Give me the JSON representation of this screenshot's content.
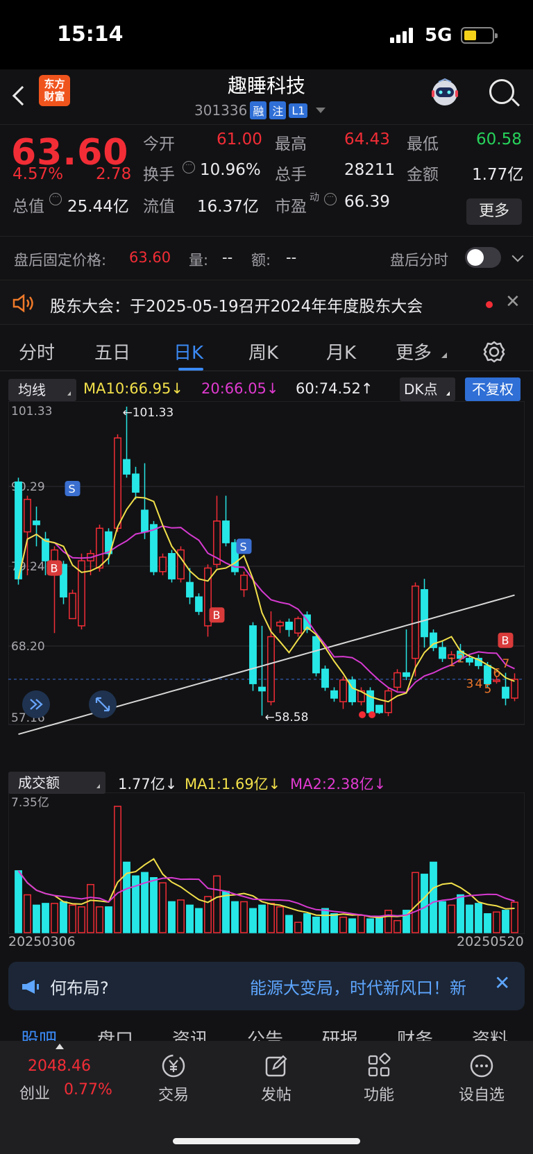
{
  "status_bar": {
    "time": "15:14",
    "network": "5G"
  },
  "header": {
    "logo_line1": "东方",
    "logo_line2": "财富",
    "stock_name": "趣睡科技",
    "stock_code": "301336",
    "tags": [
      "融",
      "注",
      "L1"
    ]
  },
  "quote": {
    "price": "63.60",
    "change_pct": "4.57%",
    "change": "2.78",
    "open_label": "今开",
    "open": "61.00",
    "high_label": "最高",
    "high": "64.43",
    "low_label": "最低",
    "low": "60.58",
    "turnover_label": "换手",
    "turnover": "10.96%",
    "volume_label": "总手",
    "volume": "28211",
    "amount_label": "金额",
    "amount": "1.77亿",
    "mktcap_label": "总值",
    "mktcap": "25.44亿",
    "float_label": "流值",
    "float_cap": "16.37亿",
    "pe_label": "市盈",
    "pe_sup": "动",
    "pe": "66.39",
    "more_button": "更多"
  },
  "after_hours": {
    "label": "盘后固定价格:",
    "price": "63.60",
    "vol_label": "量:",
    "vol": "--",
    "amt_label": "额:",
    "amt": "--",
    "timeline_label": "盘后分时"
  },
  "notice": {
    "text": "股东大会：于2025-05-19召开2024年年度股东大会",
    "close": "✕"
  },
  "tabs": [
    {
      "label": "分时"
    },
    {
      "label": "五日"
    },
    {
      "label": "日K"
    },
    {
      "label": "周K"
    },
    {
      "label": "月K"
    },
    {
      "label": "更多"
    }
  ],
  "kline_controls": {
    "indicator_select": "均线",
    "ma10": "MA10:66.95↓",
    "ma20": "20:66.05↓",
    "ma60": "60:74.52↑",
    "dk_button": "DK点",
    "adjust_button": "不复权"
  },
  "chart_data": {
    "type": "candlestick",
    "y_ticks": [
      "101.33",
      "90.29",
      "79.24",
      "68.20",
      "57.16"
    ],
    "ylim": [
      57.16,
      101.33
    ],
    "high_annotation": "101.33",
    "low_annotation": "58.58",
    "signals": [
      "B",
      "S",
      "B",
      "S",
      "B"
    ],
    "dk_numbers": [
      "1",
      "2",
      "3",
      "4",
      "5",
      "6",
      "7"
    ],
    "candles": [
      {
        "o": 90.9,
        "c": 77.5,
        "h": 91.5,
        "l": 76.7
      },
      {
        "o": 84.0,
        "c": 88.5,
        "h": 89.0,
        "l": 78.0
      },
      {
        "o": 85.5,
        "c": 85.0,
        "h": 87.5,
        "l": 82.0
      },
      {
        "o": 83.0,
        "c": 80.0,
        "h": 84.0,
        "l": 78.0
      },
      {
        "o": 78.0,
        "c": 81.5,
        "h": 82.0,
        "l": 70.0
      },
      {
        "o": 79.5,
        "c": 75.0,
        "h": 80.0,
        "l": 74.0
      },
      {
        "o": 72.0,
        "c": 75.5,
        "h": 76.0,
        "l": 72.0
      },
      {
        "o": 71.0,
        "c": 80.0,
        "h": 81.0,
        "l": 70.5
      },
      {
        "o": 80.0,
        "c": 81.0,
        "h": 81.5,
        "l": 78.0
      },
      {
        "o": 79.0,
        "c": 84.5,
        "h": 85.0,
        "l": 78.5
      },
      {
        "o": 84.0,
        "c": 81.0,
        "h": 84.5,
        "l": 79.5
      },
      {
        "o": 84.5,
        "c": 97.0,
        "h": 97.5,
        "l": 84.0
      },
      {
        "o": 94.0,
        "c": 92.0,
        "h": 101.33,
        "l": 91.5
      },
      {
        "o": 92.0,
        "c": 89.5,
        "h": 93.0,
        "l": 88.5
      },
      {
        "o": 87.0,
        "c": 84.0,
        "h": 93.5,
        "l": 83.0
      },
      {
        "o": 85.0,
        "c": 78.5,
        "h": 85.5,
        "l": 78.0
      },
      {
        "o": 78.5,
        "c": 80.5,
        "h": 81.0,
        "l": 78.0
      },
      {
        "o": 81.0,
        "c": 77.5,
        "h": 81.5,
        "l": 77.0
      },
      {
        "o": 77.5,
        "c": 81.5,
        "h": 82.0,
        "l": 77.0
      },
      {
        "o": 77.0,
        "c": 75.0,
        "h": 79.0,
        "l": 74.0
      },
      {
        "o": 75.0,
        "c": 73.0,
        "h": 75.5,
        "l": 72.5
      },
      {
        "o": 71.0,
        "c": 79.0,
        "h": 79.5,
        "l": 69.5
      },
      {
        "o": 79.5,
        "c": 85.5,
        "h": 89.0,
        "l": 79.0
      },
      {
        "o": 85.5,
        "c": 82.5,
        "h": 89.0,
        "l": 82.0
      },
      {
        "o": 82.5,
        "c": 78.5,
        "h": 83.0,
        "l": 78.0
      },
      {
        "o": 76.0,
        "c": 78.0,
        "h": 78.5,
        "l": 75.0
      },
      {
        "o": 71.0,
        "c": 63.0,
        "h": 71.5,
        "l": 62.0
      },
      {
        "o": 62.5,
        "c": 62.0,
        "h": 71.0,
        "l": 58.58
      },
      {
        "o": 60.5,
        "c": 69.5,
        "h": 73.0,
        "l": 60.0
      },
      {
        "o": 71.0,
        "c": 71.5,
        "h": 71.8,
        "l": 70.0
      },
      {
        "o": 71.5,
        "c": 70.5,
        "h": 72.0,
        "l": 69.5
      },
      {
        "o": 70.0,
        "c": 72.0,
        "h": 72.3,
        "l": 69.5
      },
      {
        "o": 72.5,
        "c": 70.5,
        "h": 73.0,
        "l": 70.0
      },
      {
        "o": 69.5,
        "c": 64.5,
        "h": 70.0,
        "l": 64.0
      },
      {
        "o": 65.0,
        "c": 62.5,
        "h": 65.5,
        "l": 62.0
      },
      {
        "o": 62.0,
        "c": 61.0,
        "h": 62.5,
        "l": 60.5
      },
      {
        "o": 60.5,
        "c": 63.5,
        "h": 64.0,
        "l": 59.5
      },
      {
        "o": 63.5,
        "c": 60.5,
        "h": 64.0,
        "l": 60.0
      },
      {
        "o": 60.5,
        "c": 62.0,
        "h": 62.5,
        "l": 60.0
      },
      {
        "o": 62.0,
        "c": 59.0,
        "h": 62.5,
        "l": 58.8
      },
      {
        "o": 60.0,
        "c": 59.0,
        "h": 60.0,
        "l": 58.8
      },
      {
        "o": 59.0,
        "c": 62.0,
        "h": 62.5,
        "l": 58.5
      },
      {
        "o": 62.5,
        "c": 64.5,
        "h": 65.0,
        "l": 62.0
      },
      {
        "o": 64.5,
        "c": 64.0,
        "h": 70.5,
        "l": 63.5
      },
      {
        "o": 66.5,
        "c": 76.5,
        "h": 77.0,
        "l": 64.0
      },
      {
        "o": 76.0,
        "c": 69.5,
        "h": 77.5,
        "l": 68.0
      },
      {
        "o": 70.0,
        "c": 68.0,
        "h": 70.5,
        "l": 67.5
      },
      {
        "o": 68.0,
        "c": 66.5,
        "h": 69.0,
        "l": 66.0
      },
      {
        "o": 66.5,
        "c": 67.0,
        "h": 67.5,
        "l": 66.5
      },
      {
        "o": 67.5,
        "c": 66.5,
        "h": 68.5,
        "l": 66.0
      },
      {
        "o": 66.5,
        "c": 66.0,
        "h": 67.0,
        "l": 65.5
      },
      {
        "o": 66.5,
        "c": 65.5,
        "h": 67.0,
        "l": 65.0
      },
      {
        "o": 65.5,
        "c": 63.0,
        "h": 66.0,
        "l": 62.5
      },
      {
        "o": 63.5,
        "c": 63.5,
        "h": 64.0,
        "l": 63.0
      },
      {
        "o": 62.5,
        "c": 61.0,
        "h": 64.5,
        "l": 60.0
      },
      {
        "o": 61.0,
        "c": 63.6,
        "h": 64.43,
        "l": 60.58
      }
    ],
    "volume": {
      "select": "成交额",
      "current": "1.77亿↓",
      "ma1": "MA1:1.69亿↓",
      "ma2": "MA2:2.38亿↓",
      "max_label": "7.35亿",
      "start_date": "20250306",
      "end_date": "20250520",
      "values": [
        3.6,
        2.2,
        1.6,
        1.7,
        1.7,
        1.8,
        1.6,
        1.5,
        2.8,
        1.5,
        1.5,
        7.35,
        4.1,
        3.3,
        3.5,
        3.2,
        2.9,
        1.8,
        1.9,
        1.6,
        1.4,
        2.1,
        3.3,
        2.4,
        1.8,
        1.8,
        1.4,
        1.6,
        1.7,
        1.5,
        1.0,
        0.6,
        1.1,
        0.9,
        1.4,
        1.1,
        0.9,
        0.8,
        1.0,
        0.8,
        0.9,
        1.3,
        0.7,
        1.3,
        3.5,
        3.4,
        4.1,
        1.8,
        1.6,
        2.2,
        1.6,
        1.7,
        1.1,
        1.2,
        1.3,
        1.77
      ]
    }
  },
  "banner": {
    "left_text": "何布局?",
    "right_text": "能源大变局，时代新风口！新",
    "close": "✕"
  },
  "subtabs": [
    "股吧",
    "盘口",
    "资讯",
    "公告",
    "研报",
    "财务",
    "资料"
  ],
  "bottom_bar": {
    "index_value": "2048.46",
    "index_name": "创业",
    "index_pct": "0.77%",
    "items": [
      {
        "label": "交易",
        "icon": "yen-trade-icon"
      },
      {
        "label": "发帖",
        "icon": "edit-post-icon"
      },
      {
        "label": "功能",
        "icon": "grid-function-icon"
      },
      {
        "label": "设自选",
        "icon": "more-dots-icon"
      }
    ]
  }
}
